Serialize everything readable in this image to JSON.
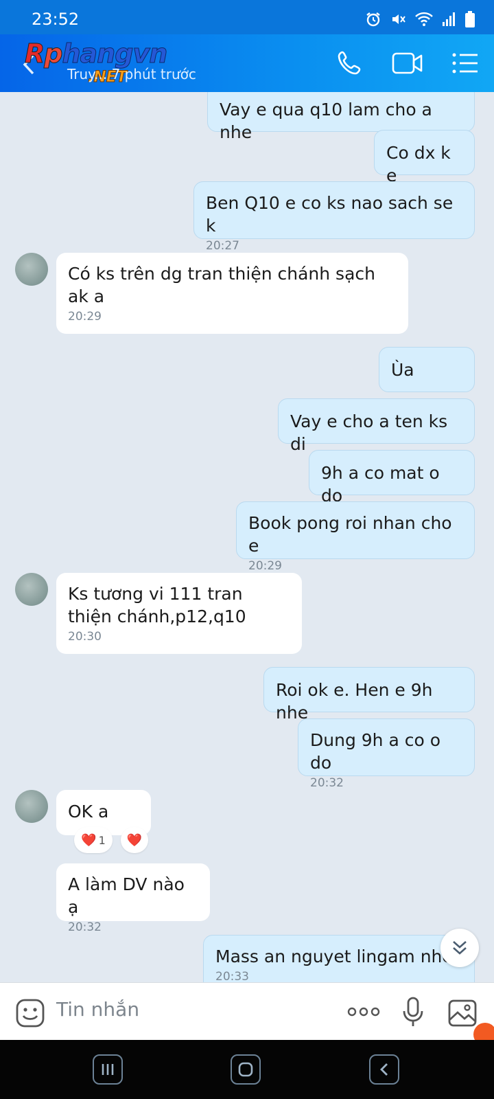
{
  "status_bar": {
    "time": "23:52",
    "icons": [
      "alarm-icon",
      "mute-icon",
      "wifi-icon",
      "signal-icon",
      "battery-icon"
    ]
  },
  "header": {
    "logo_main": "Rphangvn",
    "logo_sub": ".NET",
    "subtitle": "Truy... 7 phút trước",
    "icons": [
      "back-icon",
      "phone-icon",
      "video-icon",
      "menu-icon"
    ]
  },
  "messages": [
    {
      "dir": "out",
      "text": "Vay e qua q10 lam cho a nhe",
      "time": ""
    },
    {
      "dir": "out",
      "text": "Co dx k e",
      "time": ""
    },
    {
      "dir": "out",
      "text": "Ben Q10 e co ks nao sach se k",
      "time": "20:27"
    },
    {
      "dir": "in",
      "text": "Có ks trên dg tran thiện chánh sạch ak a",
      "time": "20:29"
    },
    {
      "dir": "out",
      "text": "Ùa",
      "time": ""
    },
    {
      "dir": "out",
      "text": "Vay e cho a ten ks di",
      "time": ""
    },
    {
      "dir": "out",
      "text": "9h a co mat o do",
      "time": ""
    },
    {
      "dir": "out",
      "text": "Book pong roi nhan cho e",
      "time": "20:29"
    },
    {
      "dir": "in",
      "text": "Ks tương vi 111 tran thiện chánh,p12,q10",
      "time": "20:30"
    },
    {
      "dir": "out",
      "text": "Roi ok e. Hen e 9h nhe",
      "time": ""
    },
    {
      "dir": "out",
      "text": "Dung 9h a co o do",
      "time": "20:32"
    },
    {
      "dir": "in",
      "text": "OK a",
      "time": ""
    },
    {
      "dir": "in",
      "text": "A làm DV nào ạ",
      "time": "20:32"
    },
    {
      "dir": "out",
      "text": "Mass an nguyet lingam nhe",
      "time": "20:33"
    }
  ],
  "reaction": {
    "emoji": "❤️",
    "count": "1",
    "add_emoji": "❤️"
  },
  "input": {
    "placeholder": "Tin nhắn"
  },
  "colors": {
    "header": "#0a76db",
    "outgoing_bubble": "#d6eefd",
    "incoming_bubble": "#ffffff",
    "background": "#e2e9f1"
  }
}
